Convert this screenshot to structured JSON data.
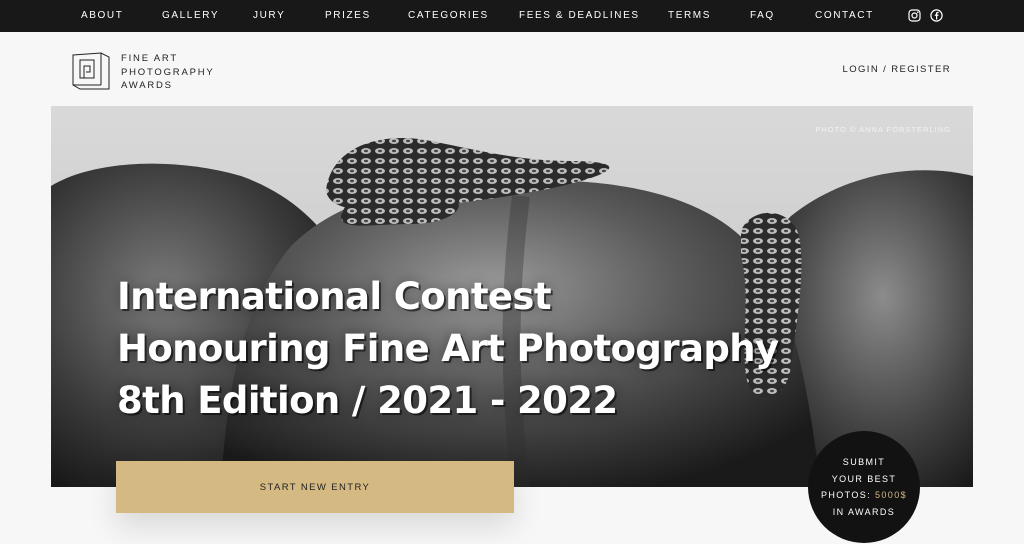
{
  "nav": {
    "items": [
      "ABOUT",
      "GALLERY",
      "JURY",
      "PRIZES",
      "CATEGORIES",
      "FEES & DEADLINES",
      "TERMS",
      "FAQ",
      "CONTACT"
    ],
    "social": [
      "instagram-icon",
      "facebook-icon"
    ]
  },
  "header": {
    "logo_lines": [
      "FINE ART",
      "PHOTOGRAPHY",
      "AWARDS"
    ],
    "login": "LOGIN / REGISTER"
  },
  "hero": {
    "credit": "PHOTO © ANNA FÖRSTERLING",
    "headline": [
      "International Contest",
      "Honouring Fine Art Photography",
      "8th Edition / 2021 - 2022"
    ]
  },
  "cta": {
    "label": "START NEW ENTRY"
  },
  "badge": {
    "line1": "SUBMIT",
    "line2": "YOUR BEST",
    "line3_prefix": "PHOTOS: ",
    "line3_amount": "5000$",
    "line4": "IN AWARDS"
  },
  "colors": {
    "accent": "#d4b982",
    "nav_bg": "#181818",
    "badge_bg": "#121212"
  }
}
